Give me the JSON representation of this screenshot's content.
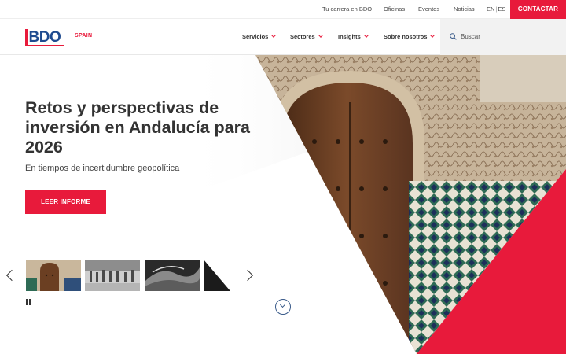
{
  "topbar": {
    "links": [
      "Tu carrera en BDO",
      "Oficinas",
      "Eventos",
      "Noticias"
    ],
    "lang_en": "EN",
    "lang_sep": "|",
    "lang_es": "ES",
    "contact_label": "CONTACTAR"
  },
  "nav": {
    "logo": "BDO",
    "country": "SPAIN",
    "items": [
      "Servicios",
      "Sectores",
      "Insights",
      "Sobre nosotros"
    ],
    "search_label": "Buscar"
  },
  "hero": {
    "title": "Retos y perspectivas de inversión en Andalucía para 2026",
    "subtitle": "En tiempos de incertidumbre geopolítica",
    "cta_label": "LEER INFORME"
  },
  "carousel": {
    "thumbnails": [
      "moorish-door-thumbnail",
      "crowd-street-thumbnail",
      "coastal-cliff-thumbnail",
      "dark-triangle-thumbnail"
    ]
  },
  "colors": {
    "brand_red": "#e81a3b",
    "brand_blue": "#1f4b8f",
    "text": "#333333"
  }
}
